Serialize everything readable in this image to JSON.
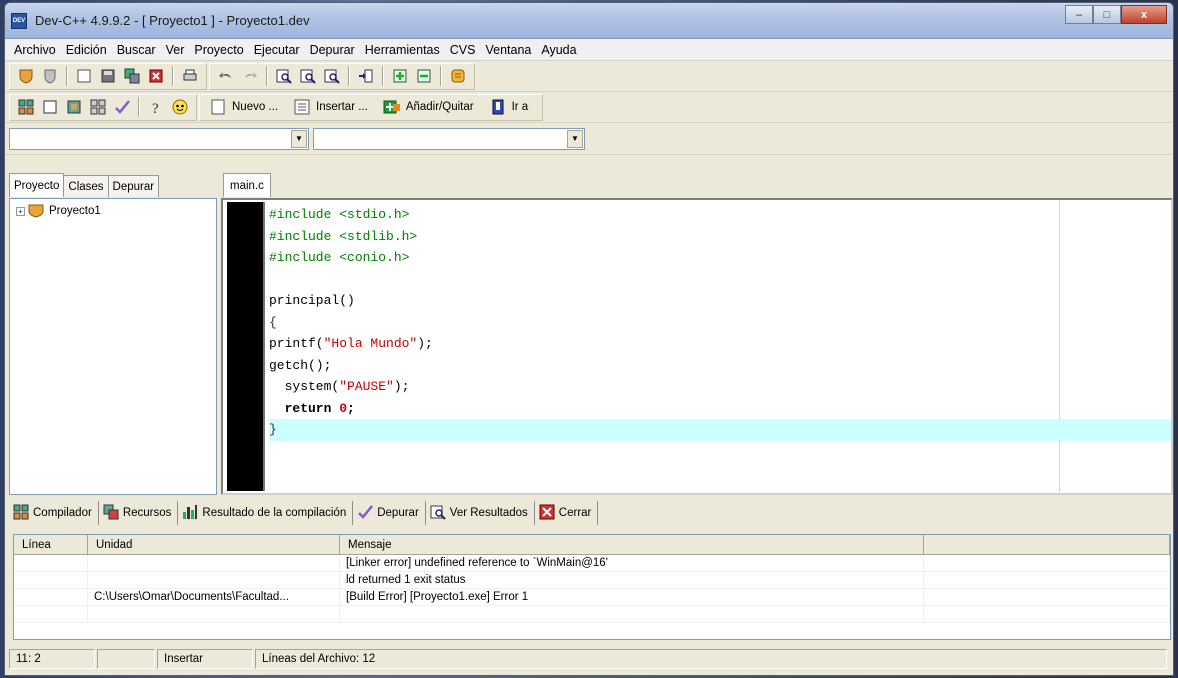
{
  "window": {
    "title": "Dev-C++ 4.9.9.2  -  [ Proyecto1 ] - Proyecto1.dev",
    "app_icon_text": "DEV",
    "controls": [
      "–",
      "□",
      "x"
    ]
  },
  "menu": [
    "Archivo",
    "Edición",
    "Buscar",
    "Ver",
    "Proyecto",
    "Ejecutar",
    "Depurar",
    "Herramientas",
    "CVS",
    "Ventana",
    "Ayuda"
  ],
  "toolbar2": {
    "nuevo": "Nuevo ...",
    "insertar": "Insertar ...",
    "anadir_quitar": "Añadir/Quitar",
    "ir_a": "Ir a"
  },
  "left_panel": {
    "tabs": [
      "Proyecto",
      "Clases",
      "Depurar"
    ],
    "tree_root": "Proyecto1"
  },
  "editor": {
    "tab": "main.c",
    "lines": [
      "#include <stdio.h>",
      "#include <stdlib.h>",
      "#include <conio.h>",
      "",
      "principal()",
      "{",
      "printf(\"Hola Mundo\");",
      "getch();",
      "  system(\"PAUSE\");",
      "  return 0;",
      "}"
    ]
  },
  "bottom_tabs": [
    "Compilador",
    "Recursos",
    "Resultado de la compilación",
    "Depurar",
    "Ver Resultados",
    "Cerrar"
  ],
  "results": {
    "headers": [
      "Línea",
      "Unidad",
      "Mensaje",
      ""
    ],
    "rows": [
      [
        "",
        "",
        "[Linker error] undefined reference to `WinMain@16'",
        ""
      ],
      [
        "",
        "",
        "ld returned 1 exit status",
        ""
      ],
      [
        "",
        "C:\\Users\\Omar\\Documents\\Facultad...",
        "[Build Error]  [Proyecto1.exe] Error 1",
        ""
      ],
      [
        "",
        "",
        "",
        ""
      ]
    ]
  },
  "status": {
    "position": "11: 2",
    "blank": "",
    "mode": "Insertar",
    "lines": "Líneas del Archivo: 12"
  },
  "colors": {
    "preprocessor": "#008000",
    "string": "#cc0000",
    "current_line": "#ccffff"
  }
}
